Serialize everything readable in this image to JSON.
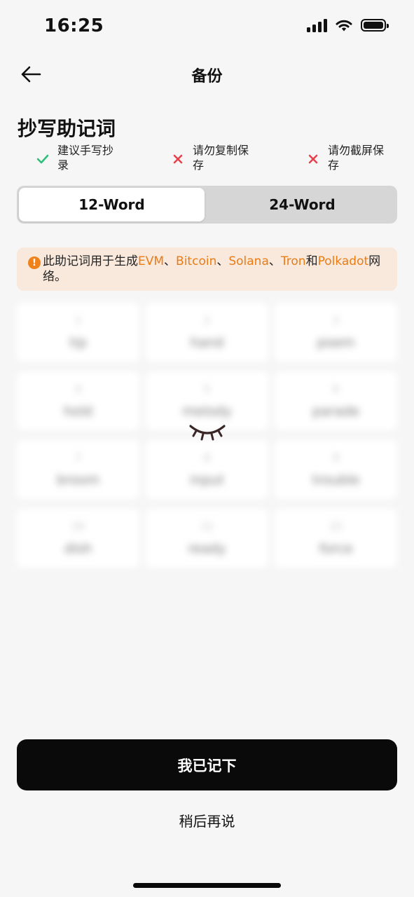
{
  "status_bar": {
    "time": "16:25"
  },
  "nav": {
    "title": "备份"
  },
  "section": {
    "title": "抄写助记词"
  },
  "tips": [
    {
      "icon": "check-icon",
      "text": "建议手写抄录",
      "ok": true
    },
    {
      "icon": "cross-icon",
      "text": "请勿复制保存",
      "ok": false
    },
    {
      "icon": "cross-icon",
      "text": "请勿截屏保存",
      "ok": false
    }
  ],
  "segments": {
    "option_12": "12-Word",
    "option_24": "24-Word",
    "selected": "12-Word"
  },
  "notice": {
    "icon": "exclamation-icon",
    "prefix": "此助记词用于生成",
    "networks": [
      "EVM",
      "Bitcoin",
      "Solana",
      "Tron",
      "Polkadot"
    ],
    "sep": "、",
    "and": "和",
    "suffix": "网络。"
  },
  "words": [
    {
      "index": "1",
      "word": "tip"
    },
    {
      "index": "2",
      "word": "hand"
    },
    {
      "index": "3",
      "word": "poem"
    },
    {
      "index": "4",
      "word": "hold"
    },
    {
      "index": "5",
      "word": "melody"
    },
    {
      "index": "6",
      "word": "parade"
    },
    {
      "index": "7",
      "word": "broom"
    },
    {
      "index": "8",
      "word": "input"
    },
    {
      "index": "9",
      "word": "trouble"
    },
    {
      "index": "10",
      "word": "dish"
    },
    {
      "index": "11",
      "word": "ready"
    },
    {
      "index": "12",
      "word": "force"
    }
  ],
  "reveal_icon": "eye-closed-icon",
  "colors": {
    "accent": "#ec7b14",
    "check": "#2bbf77",
    "cross": "#e8404a",
    "notice_bg": "#f9e9dd",
    "primary_btn": "#0a0a0a"
  },
  "actions": {
    "primary": "我已记下",
    "secondary": "稍后再说"
  }
}
